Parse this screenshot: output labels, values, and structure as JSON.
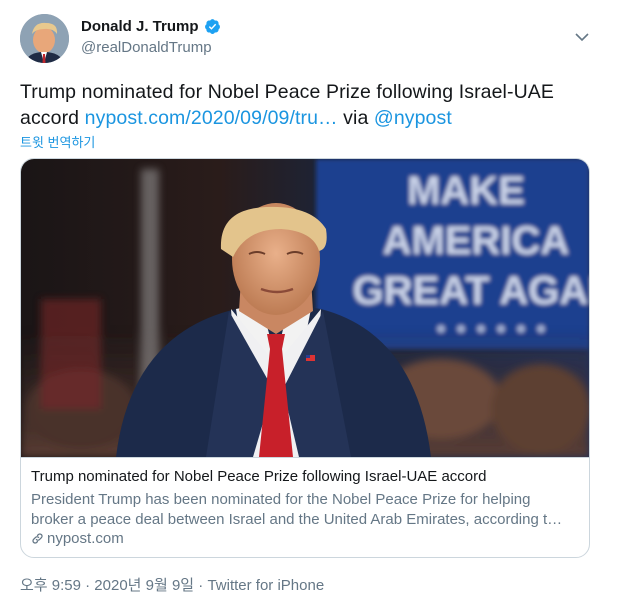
{
  "author": {
    "display_name": "Donald J. Trump",
    "handle": "@realDonaldTrump",
    "verified_icon": "verified-badge-icon",
    "avatar_icon": "profile-photo"
  },
  "tweet": {
    "text_before_link": "Trump nominated for Nobel Peace Prize following Israel-UAE accord ",
    "link_text": "nypost.com/2020/09/09/tru…",
    "via_text": " via ",
    "mention": "@nypost",
    "translate_label": "트윗 번역하기"
  },
  "card": {
    "image_sign_lines": [
      "MAKE",
      "AMERICA",
      "GREAT AGAI"
    ],
    "title": "Trump nominated for Nobel Peace Prize following Israel-UAE accord",
    "description_line1": "President Trump has been nominated for the Nobel Peace Prize for helping",
    "description_line2": "broker a peace deal between Israel and the United Arab Emirates, according t…",
    "domain": "nypost.com",
    "domain_icon": "link-icon"
  },
  "meta": {
    "timestamp": "오후 9:59 · 2020년 9월 9일",
    "separator": " · ",
    "source": "Twitter for iPhone"
  },
  "colors": {
    "link": "#1b95e0",
    "secondary_text": "#657786",
    "primary_text": "#14171a",
    "border": "#ccd6dd"
  }
}
